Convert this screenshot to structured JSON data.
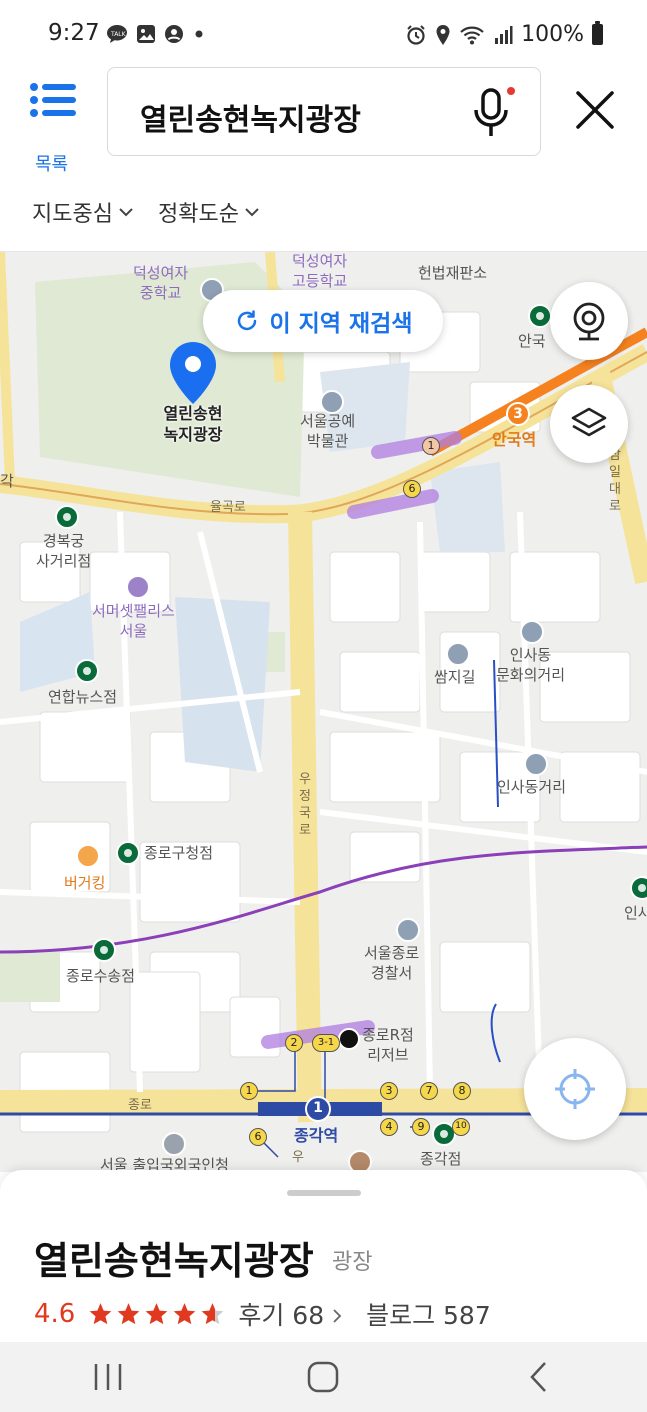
{
  "status_bar": {
    "time": "9:27",
    "battery": "100%"
  },
  "header": {
    "list_label": "목록",
    "search_query": "열린송현녹지광장",
    "filters": [
      "지도중심",
      "정확도순"
    ]
  },
  "map": {
    "research_label": "이 지역 재검색",
    "pin_label_line1": "열린송현",
    "pin_label_line2": "녹지광장",
    "labels": {
      "deoksung_girls_middle_1": "덕성여자",
      "deoksung_girls_middle_2": "중학교",
      "deoksung_girls_high_1": "덕성여자",
      "deoksung_girls_high_2": "고등학교",
      "constitutional_court": "헌법재판소",
      "anguk_small": "안국",
      "crafts_museum_1": "서울공예",
      "crafts_museum_2": "박물관",
      "anguk_station": "안국역",
      "yulgok_ro": "율곡로",
      "gak": "각",
      "gyeongbokgung_1": "경복궁",
      "gyeongbokgung_2": "사거리점",
      "somerset_1": "서머셋팰리스",
      "somerset_2": "서울",
      "yonhap": "연합뉴스점",
      "ssamziegil": "쌈지길",
      "insadong_culture_1": "인사동",
      "insadong_culture_2": "문화의거리",
      "insadong_street": "인사동거리",
      "ujeongguk_ro": "우정국로",
      "jongno_gu_office": "종로구청점",
      "burgerking": "버거킹",
      "jongno_susong": "종로수송점",
      "jongno_police_1": "서울종로",
      "jongno_police_2": "경찰서",
      "jongno_r_1": "종로R점",
      "jongno_r_2": "리저브",
      "jongno_road": "종로",
      "jonggak_station": "종각역",
      "jonggak": "종각점",
      "immigration": "서울 출입국외국인청",
      "ins_right": "인사",
      "u_bottom": "우",
      "samildae_ro": "삼일대로"
    },
    "exits": [
      "1",
      "6",
      "1",
      "2",
      "3-1",
      "3",
      "4",
      "6",
      "7",
      "8",
      "9",
      "10"
    ],
    "line_numbers": {
      "anguk": "3",
      "jonggak": "1"
    }
  },
  "place": {
    "name": "열린송현녹지광장",
    "category": "광장",
    "rating": "4.6",
    "review": "후기 68",
    "blog": "블로그 587",
    "rating_value": 4.6
  },
  "colors": {
    "accent": "#1a73e8",
    "rating": "#e0391f",
    "line3": "#f5821f",
    "line1": "#2d4ba5",
    "park": "#dfe9d3",
    "road": "#f6e39a"
  }
}
